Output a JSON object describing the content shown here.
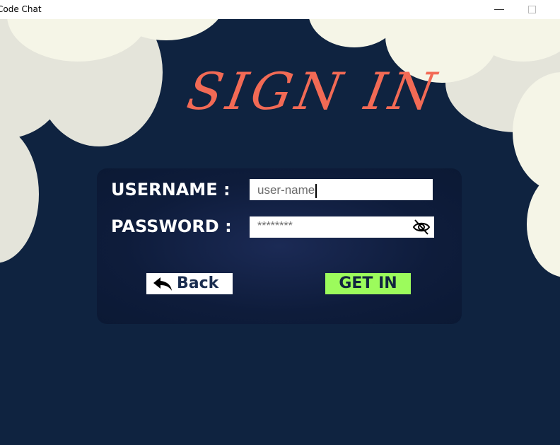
{
  "window": {
    "title": "Code Chat",
    "minimize_glyph": "—"
  },
  "heading": "SIGN IN",
  "form": {
    "username_label": "USERNAME  :",
    "password_label": "PASSWORD :",
    "username_value": "user-name",
    "password_value": "********",
    "password_toggle_icon": "eye-slash-icon"
  },
  "buttons": {
    "back_label": "Back",
    "back_icon": "reply-arrow-icon",
    "submit_label": "GET IN"
  },
  "colors": {
    "background": "#0f2340",
    "panel": "#0e1c3b",
    "heading": "#f26a55",
    "submit_button": "#9cfb5c",
    "cloud_light": "#f5f5e7",
    "cloud_dark": "#e4e4da"
  }
}
